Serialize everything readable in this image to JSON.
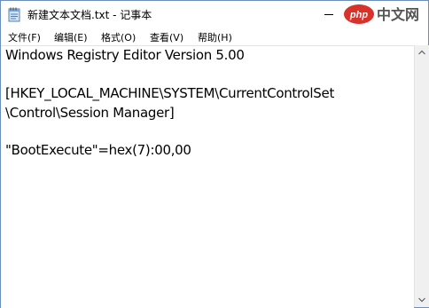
{
  "window": {
    "title": "新建文本文档.txt - 记事本",
    "watermark_text": "php 中文网"
  },
  "menu": {
    "file": "文件(F)",
    "edit": "编辑(E)",
    "format": "格式(O)",
    "view": "查看(V)",
    "help": "帮助(H)"
  },
  "document": {
    "lines": [
      "Windows Registry Editor Version 5.00",
      "",
      "[HKEY_LOCAL_MACHINE\\SYSTEM\\CurrentControlSet",
      "\\Control\\Session Manager]",
      "",
      "\"BootExecute\"=hex(7):00,00"
    ]
  },
  "colors": {
    "watermark_red": "#d9322a",
    "watermark_gray": "#555555",
    "border": "#6b8fb8"
  },
  "icons": {
    "app": "notepad-icon",
    "minimize": "minimize-icon",
    "scroll_up": "chevron-up-icon",
    "scroll_down": "chevron-down-icon"
  }
}
